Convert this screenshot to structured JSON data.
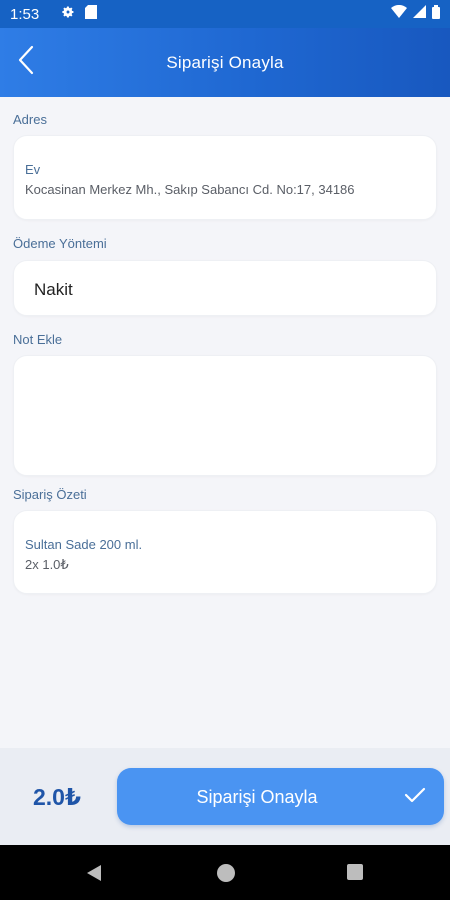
{
  "status_bar": {
    "time": "1:53",
    "icons": [
      "gear-icon",
      "sd-card-icon",
      "wifi-icon",
      "signal-icon",
      "battery-icon"
    ]
  },
  "header": {
    "title": "Siparişi Onayla",
    "back_icon": "chevron-left-icon"
  },
  "address": {
    "label": "Adres",
    "title": "Ev",
    "line": "Kocasinan Merkez Mh., Sakıp Sabancı Cd. No:17, 34186"
  },
  "payment": {
    "label": "Ödeme Yöntemi",
    "value": "Nakit"
  },
  "note": {
    "label": "Not Ekle",
    "value": ""
  },
  "summary": {
    "label": "Sipariş Özeti",
    "items": [
      {
        "name": "Sultan Sade 200 ml.",
        "qty_price": "2x  1.0₺"
      }
    ]
  },
  "footer": {
    "total": "2.0₺",
    "confirm_label": "Siparişi Onayla",
    "confirm_icon": "check-icon"
  },
  "nav": {
    "icons": [
      "back-triangle-icon",
      "home-circle-icon",
      "recents-square-icon"
    ]
  },
  "colors": {
    "header_start": "#2f7de6",
    "header_end": "#1858bf",
    "button": "#4a94f2",
    "total": "#1f55a8",
    "label": "#4a6f98",
    "background": "#f4f5f9"
  }
}
